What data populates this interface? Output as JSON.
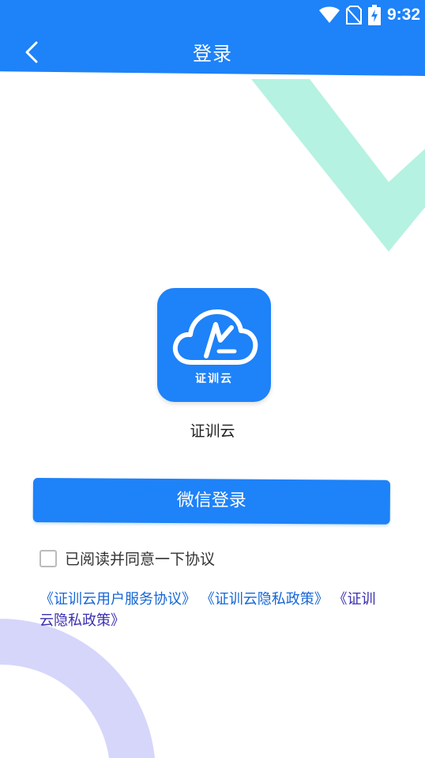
{
  "status_bar": {
    "time": "9:32",
    "icons": [
      "wifi-icon",
      "no-sim-icon",
      "battery-charging-icon"
    ]
  },
  "nav": {
    "title": "登录",
    "back_icon": "chevron-left-icon"
  },
  "app": {
    "logo_text": "证训云",
    "name": "证训云"
  },
  "login": {
    "wechat_label": "微信登录"
  },
  "agreement": {
    "checked": false,
    "label": "已阅读并同意一下协议",
    "links": [
      "《证训云用户服务协议》",
      "《证训云隐私政策》",
      "《证训云隐私政策》"
    ]
  },
  "colors": {
    "primary": "#1e82f8",
    "decor_teal": "#b6f2e1",
    "decor_lavender": "#d6d6fb",
    "link": "#1566d6"
  }
}
